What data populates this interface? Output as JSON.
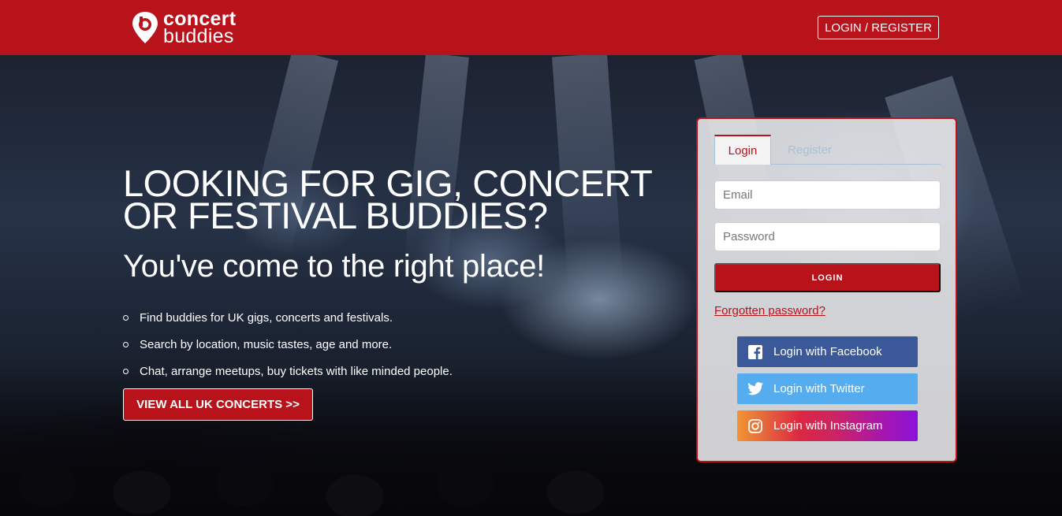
{
  "header": {
    "logo_line1": "concert",
    "logo_line2": "buddies",
    "login_register_label": "LOGIN / REGISTER"
  },
  "hero": {
    "headline": "LOOKING FOR GIG, CONCERT OR FESTIVAL BUDDIES?",
    "subheadline": "You've come to the right place!",
    "features": [
      "Find buddies for UK gigs, concerts and festivals.",
      "Search by location, music tastes, age and more.",
      "Chat, arrange meetups, buy tickets with like minded people."
    ],
    "cta_label": "VIEW ALL UK CONCERTS >>"
  },
  "auth_panel": {
    "tabs": [
      {
        "label": "Login",
        "active": true
      },
      {
        "label": "Register",
        "active": false
      }
    ],
    "email_placeholder": "Email",
    "password_placeholder": "Password",
    "login_button_label": "LOGIN",
    "forgot_link": "Forgotten password?",
    "social": [
      {
        "label": "Login with Facebook",
        "icon": "facebook-icon",
        "color": "#3b5998"
      },
      {
        "label": "Login with Twitter",
        "icon": "twitter-icon",
        "color": "#55acee"
      },
      {
        "label": "Login with Instagram",
        "icon": "instagram-icon",
        "color": "#c13584"
      }
    ]
  },
  "colors": {
    "brand_red": "#b8121b",
    "tab_border": "#a9c1d6"
  }
}
